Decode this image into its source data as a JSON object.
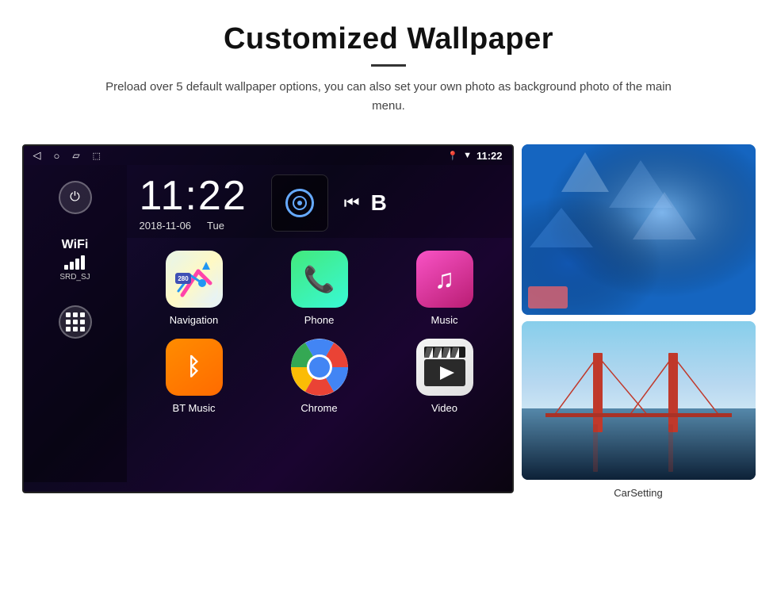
{
  "header": {
    "title": "Customized Wallpaper",
    "description": "Preload over 5 default wallpaper options, you can also set your own photo as background photo of the main menu."
  },
  "device": {
    "status_bar": {
      "time": "11:22",
      "wifi_icon": "wifi",
      "location_icon": "location"
    },
    "clock": {
      "time": "11:22",
      "date": "2018-11-06",
      "day": "Tue"
    },
    "sidebar": {
      "wifi_label": "WiFi",
      "wifi_network": "SRD_SJ"
    },
    "apps": [
      {
        "name": "Navigation",
        "type": "navigation"
      },
      {
        "name": "Phone",
        "type": "phone"
      },
      {
        "name": "Music",
        "type": "music"
      },
      {
        "name": "BT Music",
        "type": "bt_music"
      },
      {
        "name": "Chrome",
        "type": "chrome"
      },
      {
        "name": "Video",
        "type": "video"
      }
    ]
  },
  "wallpapers": {
    "top_label": "ice-blue",
    "bottom_label": "bridge-sky",
    "carsetting_label": "CarSetting"
  }
}
